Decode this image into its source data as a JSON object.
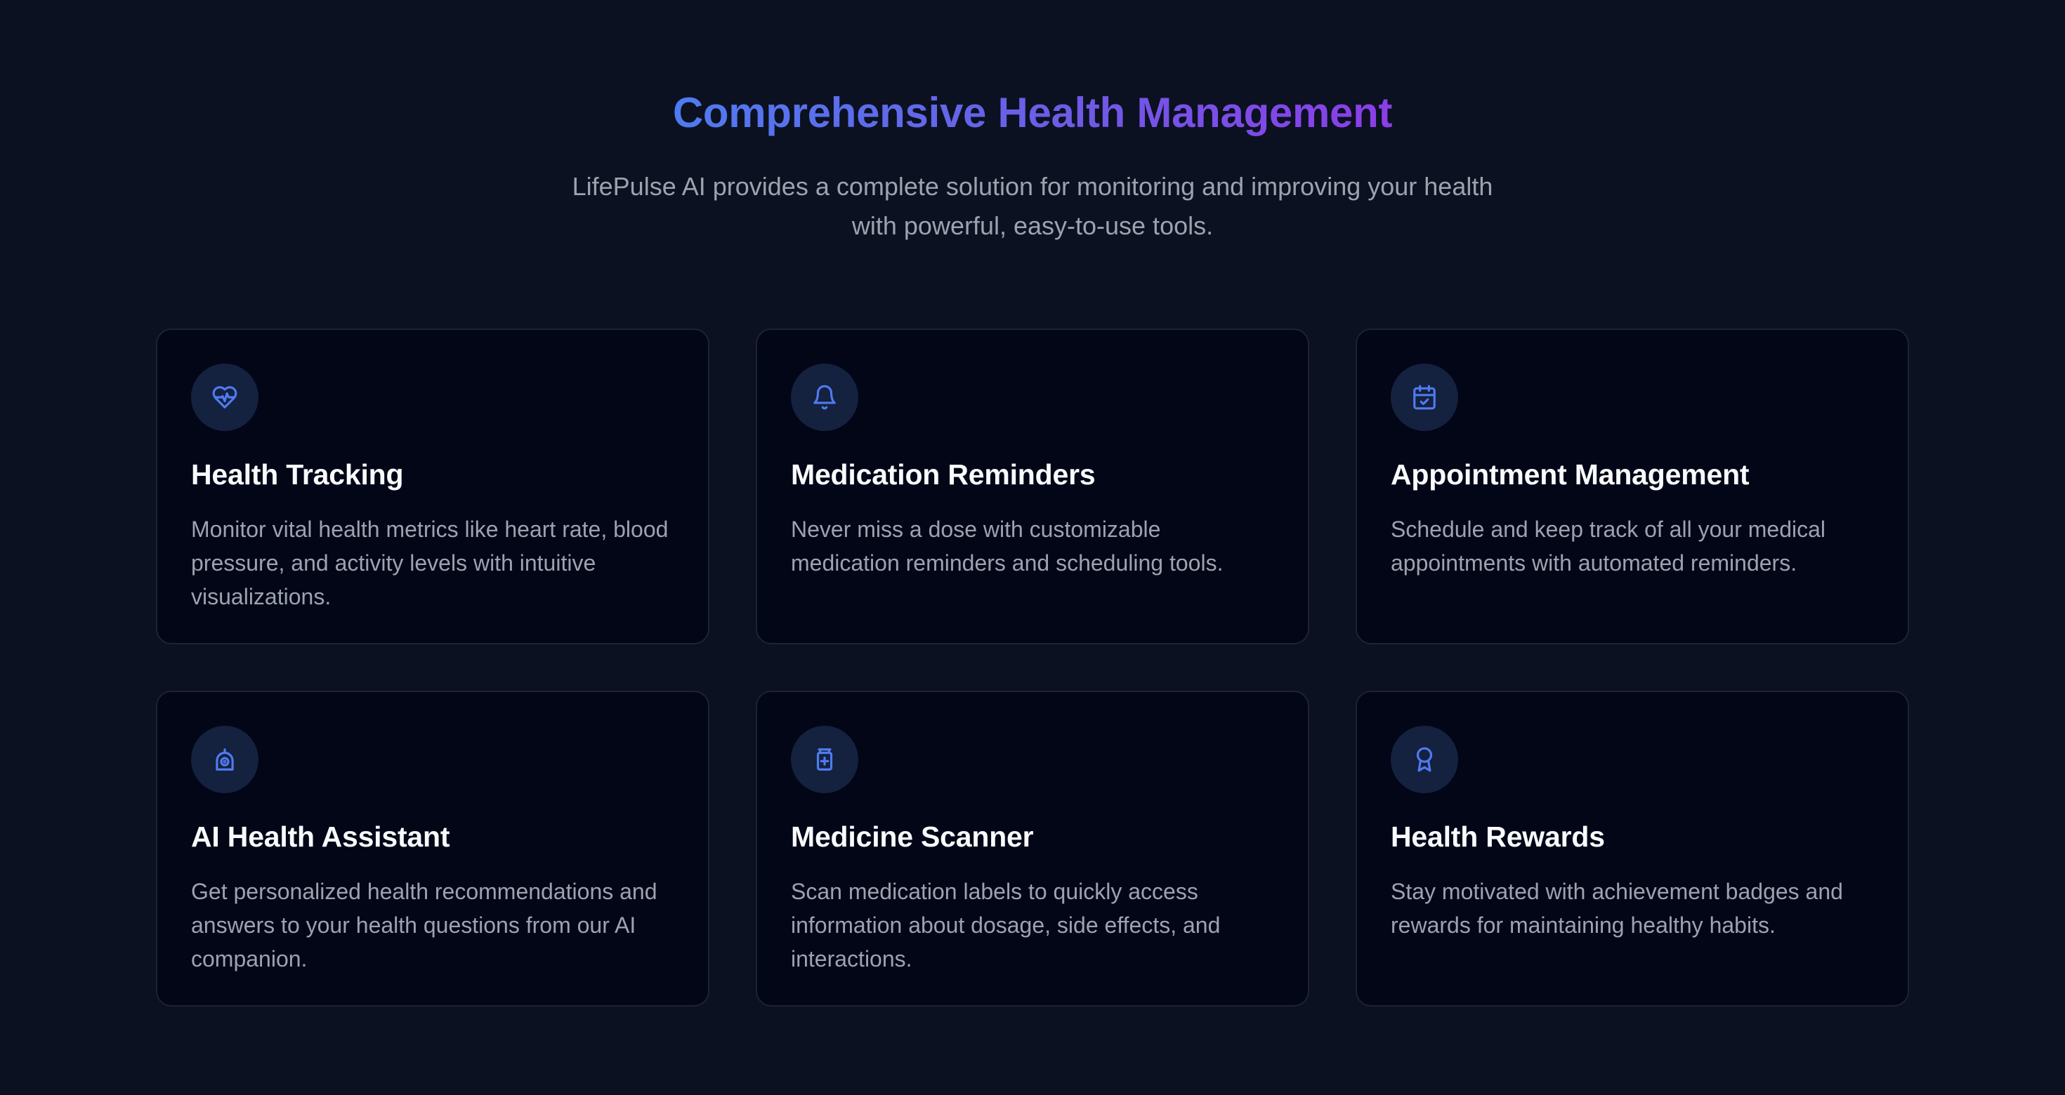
{
  "section": {
    "title": "Comprehensive Health Management",
    "subtitle": "LifePulse AI provides a complete solution for monitoring and improving your health with powerful, easy-to-use tools."
  },
  "features": [
    {
      "icon": "heart-pulse-icon",
      "title": "Health Tracking",
      "description": "Monitor vital health metrics like heart rate, blood pressure, and activity levels with intuitive visualizations."
    },
    {
      "icon": "bell-icon",
      "title": "Medication Reminders",
      "description": "Never miss a dose with customizable medication reminders and scheduling tools."
    },
    {
      "icon": "calendar-check-icon",
      "title": "Appointment Management",
      "description": "Schedule and keep track of all your medical appointments with automated reminders."
    },
    {
      "icon": "robot-assistant-icon",
      "title": "AI Health Assistant",
      "description": "Get personalized health recommendations and answers to your health questions from our AI companion."
    },
    {
      "icon": "medicine-bottle-icon",
      "title": "Medicine Scanner",
      "description": "Scan medication labels to quickly access information about dosage, side effects, and interactions."
    },
    {
      "icon": "award-ribbon-icon",
      "title": "Health Rewards",
      "description": "Stay motivated with achievement badges and rewards for maintaining healthy habits."
    }
  ],
  "colors": {
    "background": "#0b1120",
    "card_background": "#020617",
    "card_border": "#1c2333",
    "icon_background": "#14213f",
    "icon_stroke": "#4f7bf0",
    "title_gradient_start": "#4f7bf0",
    "title_gradient_end": "#8b3de8",
    "heading_text": "#f8fafc",
    "body_text": "#9ca3af"
  }
}
